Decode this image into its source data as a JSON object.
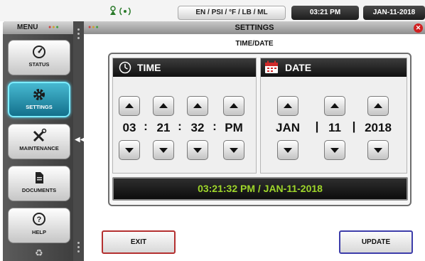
{
  "topbar": {
    "units": "EN / PSI / °F / LB / ML",
    "time": "03:21 PM",
    "date": "JAN-11-2018"
  },
  "sidebar": {
    "title": "MENU",
    "items": [
      {
        "label": "STATUS",
        "icon": "gauge-icon",
        "active": false
      },
      {
        "label": "SETTINGS",
        "icon": "gear-icon",
        "active": true
      },
      {
        "label": "MAINTENANCE",
        "icon": "tools-icon",
        "active": false
      },
      {
        "label": "DOCUMENTS",
        "icon": "document-icon",
        "active": false
      },
      {
        "label": "HELP",
        "icon": "help-icon",
        "active": false
      }
    ]
  },
  "window": {
    "title": "SETTINGS",
    "subtitle": "TIME/DATE"
  },
  "time": {
    "header": "TIME",
    "hour": "03",
    "minute": "21",
    "second": "32",
    "ampm": "PM",
    "separator": ":"
  },
  "date": {
    "header": "DATE",
    "month": "JAN",
    "day": "11",
    "year": "2018",
    "separator": "|"
  },
  "status_display": "03:21:32 PM / JAN-11-2018",
  "buttons": {
    "exit": "EXIT",
    "update": "UPDATE"
  },
  "colors": {
    "active_nav": "#2a98b6",
    "status_text": "#9ed62a",
    "exit_border": "#b43030",
    "update_border": "#3d3daa",
    "close": "#d12020"
  }
}
